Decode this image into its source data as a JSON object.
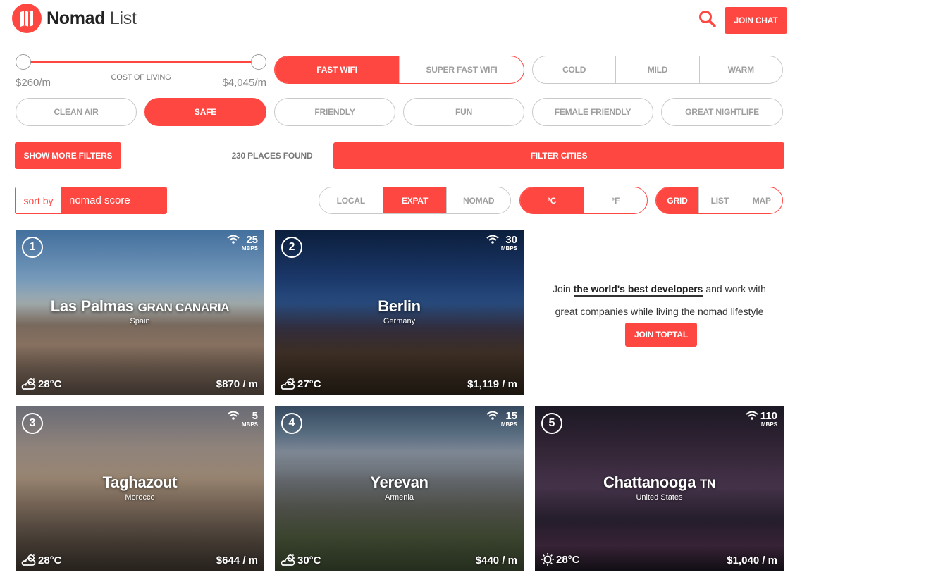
{
  "header": {
    "brand_bold": "Nomad",
    "brand_light": "List",
    "join_chat": "JOIN CHAT"
  },
  "filters": {
    "cost": {
      "caption": "COST OF LIVING",
      "min": "$260/m",
      "max": "$4,045/m"
    },
    "wifi": [
      "FAST WIFI",
      "SUPER FAST WIFI"
    ],
    "climate": [
      "COLD",
      "MILD",
      "WARM"
    ],
    "tags": [
      "CLEAN AIR",
      "SAFE",
      "FRIENDLY",
      "FUN",
      "FEMALE FRIENDLY",
      "GREAT NIGHTLIFE"
    ],
    "show_more": "SHOW MORE FILTERS",
    "places_found": "230 PLACES FOUND",
    "filter_cities": "FILTER CITIES"
  },
  "sort": {
    "label": "sort by",
    "value": "nomad score"
  },
  "perspective": [
    "LOCAL",
    "EXPAT",
    "NOMAD"
  ],
  "units": [
    "°C",
    "°F"
  ],
  "views": [
    "GRID",
    "LIST",
    "MAP"
  ],
  "cities": [
    {
      "rank": "1",
      "name": "Las Palmas",
      "region": "GRAN CANARIA",
      "country": "Spain",
      "wifi": "25",
      "wifi_unit": "MBPS",
      "temp": "28°C",
      "cost": "$870 / m"
    },
    {
      "rank": "2",
      "name": "Berlin",
      "region": "",
      "country": "Germany",
      "wifi": "30",
      "wifi_unit": "MBPS",
      "temp": "27°C",
      "cost": "$1,119 / m"
    },
    {
      "rank": "3",
      "name": "Taghazout",
      "region": "",
      "country": "Morocco",
      "wifi": "5",
      "wifi_unit": "MBPS",
      "temp": "28°C",
      "cost": "$644 / m"
    },
    {
      "rank": "4",
      "name": "Yerevan",
      "region": "",
      "country": "Armenia",
      "wifi": "15",
      "wifi_unit": "MBPS",
      "temp": "30°C",
      "cost": "$440 / m"
    },
    {
      "rank": "5",
      "name": "Chattanooga",
      "region": "TN",
      "country": "United States",
      "wifi": "110",
      "wifi_unit": "MBPS",
      "temp": "28°C",
      "cost": "$1,040 / m"
    }
  ],
  "ad": {
    "prefix": "Join",
    "link": "the world's best developers",
    "suffix": "and work with",
    "line2": "great companies while living the nomad lifestyle",
    "button": "JOIN TOPTAL"
  },
  "colors": {
    "accent": "#ff4742"
  }
}
